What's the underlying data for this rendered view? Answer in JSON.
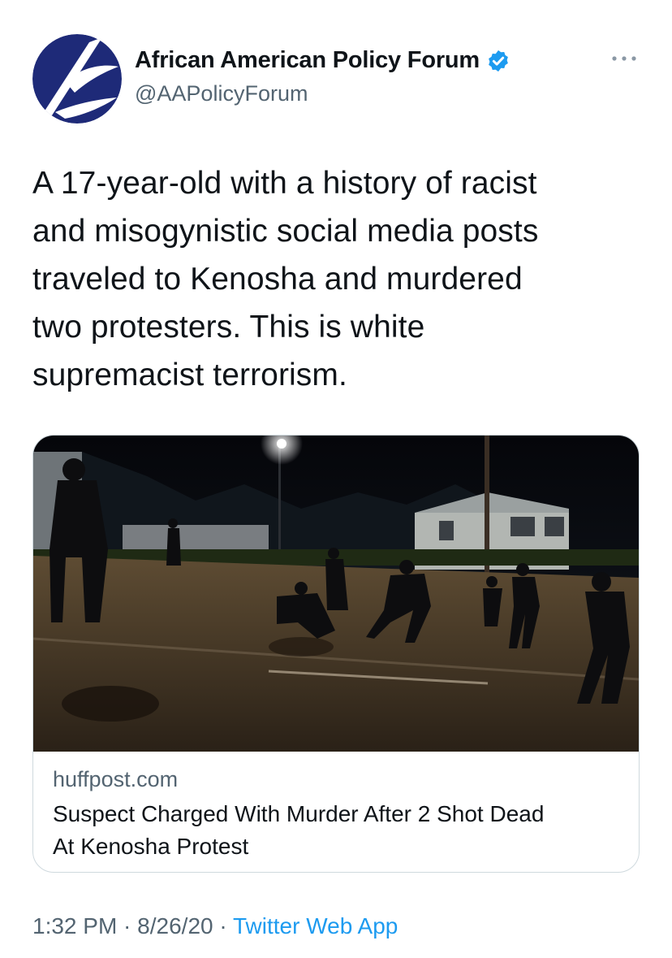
{
  "author": {
    "display_name": "African American Policy Forum",
    "handle": "@AAPolicyForum",
    "verified": true,
    "avatar_icon": "aapf-logo",
    "colors": {
      "logo_navy": "#1e2a78",
      "verified": "#1d9bf0"
    }
  },
  "menu": {
    "icon": "more-horizontal-icon"
  },
  "tweet": {
    "lines": [
      "A 17-year-old with a history of racist",
      "and misogynistic social media posts",
      "traveled to Kenosha and murdered",
      "two protesters. This is white",
      "supremacist terrorism."
    ]
  },
  "card": {
    "domain": "huffpost.com",
    "title_lines": [
      "Suspect Charged With Murder After 2 Shot Dead",
      "At Kenosha Protest"
    ]
  },
  "meta": {
    "time": "1:32 PM",
    "date": "8/26/20",
    "separator": " · ",
    "source": "Twitter Web App"
  }
}
